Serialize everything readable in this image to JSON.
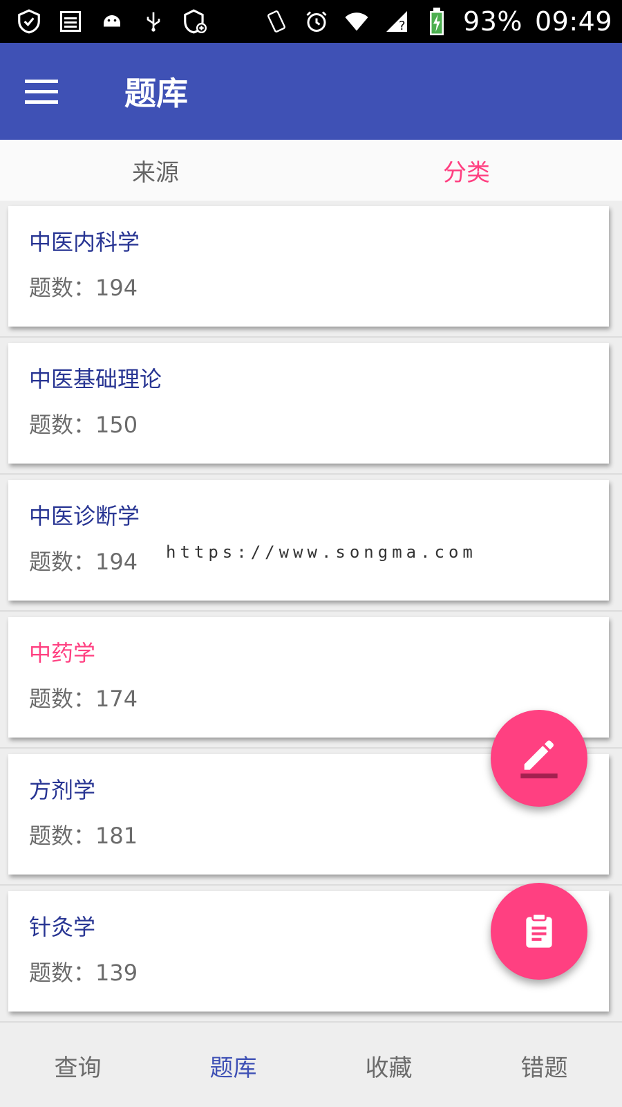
{
  "status_bar": {
    "battery": "93%",
    "time": "09:49",
    "icons_left": [
      "shield-check-icon",
      "storage-icon",
      "android-icon",
      "usb-icon",
      "shield-plus-icon"
    ],
    "icons_right": [
      "vibrate-icon",
      "alarm-icon",
      "wifi-icon",
      "signal-icon",
      "battery-charging-icon"
    ]
  },
  "app_bar": {
    "title": "题库",
    "menu_icon": "menu-icon",
    "color": "#3f51b5"
  },
  "tabs": [
    {
      "label": "来源",
      "active": false
    },
    {
      "label": "分类",
      "active": true
    }
  ],
  "accent_color": "#ff4081",
  "categories": [
    {
      "name": "中医内科学",
      "count_label": "题数：194"
    },
    {
      "name": "中医基础理论",
      "count_label": "题数：150"
    },
    {
      "name": "中医诊断学",
      "count_label": "题数：194"
    },
    {
      "name": "中药学",
      "count_label": "题数：174"
    },
    {
      "name": "方剂学",
      "count_label": "题数：181"
    },
    {
      "name": "针灸学",
      "count_label": "题数：139"
    }
  ],
  "watermark": "https://www.songma.com",
  "fabs": [
    {
      "icon": "edit-icon"
    },
    {
      "icon": "clipboard-icon"
    }
  ],
  "bottom_nav": [
    {
      "label": "查询",
      "active": false
    },
    {
      "label": "题库",
      "active": true
    },
    {
      "label": "收藏",
      "active": false
    },
    {
      "label": "错题",
      "active": false
    }
  ]
}
